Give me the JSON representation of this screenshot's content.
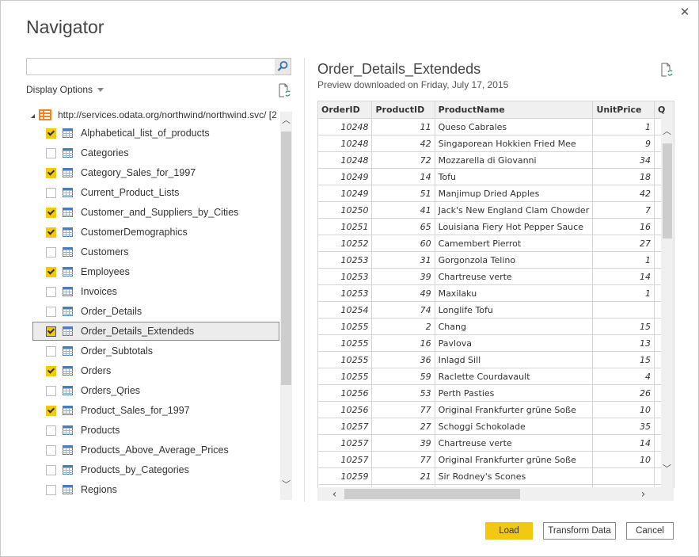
{
  "dialog": {
    "title": "Navigator",
    "close_icon": "close-icon"
  },
  "search": {
    "value": "",
    "placeholder": "",
    "icon": "search-icon"
  },
  "display_options": {
    "label": "Display Options"
  },
  "tree": {
    "root": {
      "label": "http://services.odata.org/northwind/northwind.svc/ [2",
      "icon": "odata-feed-icon",
      "expanded": true
    },
    "items": [
      {
        "label": "Alphabetical_list_of_products",
        "checked": true,
        "selected": false
      },
      {
        "label": "Categories",
        "checked": false,
        "selected": false
      },
      {
        "label": "Category_Sales_for_1997",
        "checked": true,
        "selected": false
      },
      {
        "label": "Current_Product_Lists",
        "checked": false,
        "selected": false
      },
      {
        "label": "Customer_and_Suppliers_by_Cities",
        "checked": true,
        "selected": false
      },
      {
        "label": "CustomerDemographics",
        "checked": true,
        "selected": false
      },
      {
        "label": "Customers",
        "checked": false,
        "selected": false
      },
      {
        "label": "Employees",
        "checked": true,
        "selected": false
      },
      {
        "label": "Invoices",
        "checked": false,
        "selected": false
      },
      {
        "label": "Order_Details",
        "checked": false,
        "selected": false
      },
      {
        "label": "Order_Details_Extendeds",
        "checked": true,
        "selected": true
      },
      {
        "label": "Order_Subtotals",
        "checked": false,
        "selected": false
      },
      {
        "label": "Orders",
        "checked": true,
        "selected": false
      },
      {
        "label": "Orders_Qries",
        "checked": false,
        "selected": false
      },
      {
        "label": "Product_Sales_for_1997",
        "checked": true,
        "selected": false
      },
      {
        "label": "Products",
        "checked": false,
        "selected": false
      },
      {
        "label": "Products_Above_Average_Prices",
        "checked": false,
        "selected": false
      },
      {
        "label": "Products_by_Categories",
        "checked": false,
        "selected": false
      },
      {
        "label": "Regions",
        "checked": false,
        "selected": false
      }
    ]
  },
  "preview": {
    "title": "Order_Details_Extendeds",
    "subtitle": "Preview downloaded on Friday, July 17, 2015",
    "columns": [
      "OrderID",
      "ProductID",
      "ProductName",
      "UnitPrice",
      "Q"
    ],
    "rows": [
      [
        "10248",
        "11",
        "Queso Cabrales",
        "1"
      ],
      [
        "10248",
        "42",
        "Singaporean Hokkien Fried Mee",
        "9"
      ],
      [
        "10248",
        "72",
        "Mozzarella di Giovanni",
        "34"
      ],
      [
        "10249",
        "14",
        "Tofu",
        "18"
      ],
      [
        "10249",
        "51",
        "Manjimup Dried Apples",
        "42"
      ],
      [
        "10250",
        "41",
        "Jack's New England Clam Chowder",
        "7"
      ],
      [
        "10251",
        "65",
        "Louisiana Fiery Hot Pepper Sauce",
        "16"
      ],
      [
        "10252",
        "60",
        "Camembert Pierrot",
        "27"
      ],
      [
        "10253",
        "31",
        "Gorgonzola Telino",
        "1"
      ],
      [
        "10253",
        "39",
        "Chartreuse verte",
        "14"
      ],
      [
        "10253",
        "49",
        "Maxilaku",
        "1"
      ],
      [
        "10254",
        "74",
        "Longlife Tofu",
        ""
      ],
      [
        "10255",
        "2",
        "Chang",
        "15"
      ],
      [
        "10255",
        "16",
        "Pavlova",
        "13"
      ],
      [
        "10255",
        "36",
        "Inlagd Sill",
        "15"
      ],
      [
        "10255",
        "59",
        "Raclette Courdavault",
        "4"
      ],
      [
        "10256",
        "53",
        "Perth Pasties",
        "26"
      ],
      [
        "10256",
        "77",
        "Original Frankfurter grüne Soße",
        "10"
      ],
      [
        "10257",
        "27",
        "Schoggi Schokolade",
        "35"
      ],
      [
        "10257",
        "39",
        "Chartreuse verte",
        "14"
      ],
      [
        "10257",
        "77",
        "Original Frankfurter grüne Soße",
        "10"
      ],
      [
        "10259",
        "21",
        "Sir Rodney's Scones",
        ""
      ],
      [
        "",
        "",
        "",
        ""
      ]
    ]
  },
  "buttons": {
    "load": "Load",
    "transform": "Transform Data",
    "cancel": "Cancel"
  },
  "colors": {
    "accent": "#f2c811",
    "table_icon": "#4a7ebb",
    "odata_icon": "#f58220"
  }
}
